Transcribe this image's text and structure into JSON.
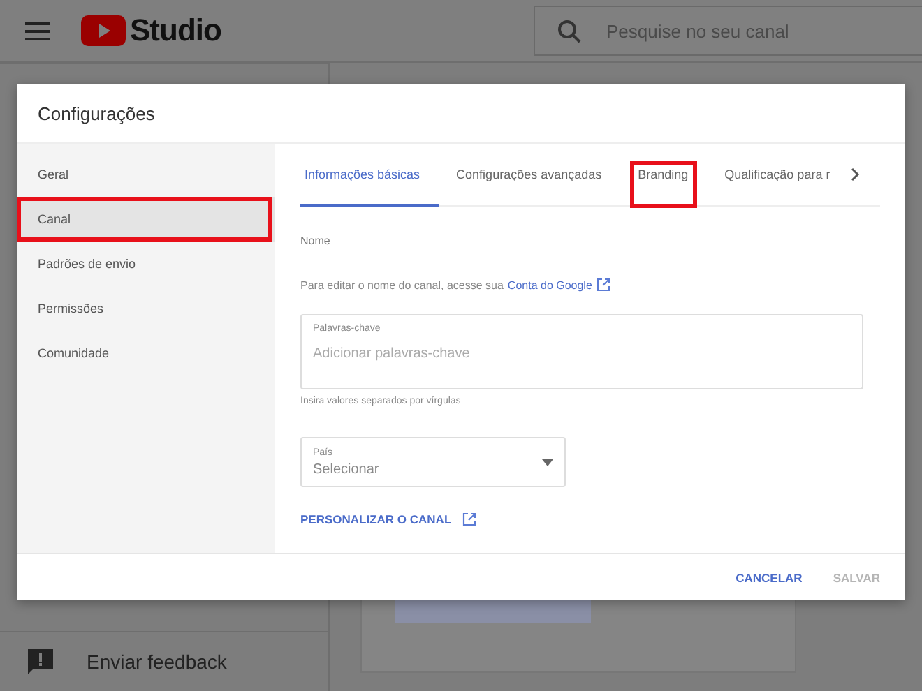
{
  "topbar": {
    "logo": "Studio",
    "search": {
      "placeholder": "Pesquise no seu canal"
    }
  },
  "background_nav": {
    "items": [
      {
        "label": "Enviar feedback",
        "kind": "feedback"
      }
    ]
  },
  "dialog": {
    "title": "Configurações",
    "sidebar": {
      "items": [
        {
          "label": "Geral",
          "selected": false,
          "highlighted": false
        },
        {
          "label": "Canal",
          "selected": true,
          "highlighted": true
        },
        {
          "label": "Padrões de envio",
          "selected": false,
          "highlighted": false
        },
        {
          "label": "Permissões",
          "selected": false,
          "highlighted": false
        },
        {
          "label": "Comunidade",
          "selected": false,
          "highlighted": false
        }
      ]
    },
    "tabs": [
      {
        "label": "Informações básicas",
        "selected": true,
        "highlighted": false
      },
      {
        "label": "Configurações avançadas",
        "selected": false,
        "highlighted": false
      },
      {
        "label": "Branding",
        "selected": false,
        "highlighted": true
      },
      {
        "label": "Qualificação para r",
        "selected": false,
        "highlighted": false
      }
    ],
    "name_label": "Nome",
    "name_hint": "Para editar o nome do canal, acesse sua",
    "name_link": "Conta do Google",
    "keywords": {
      "label": "Palavras-chave",
      "placeholder": "Adicionar palavras-chave",
      "hint": "Insira valores separados por vírgulas"
    },
    "country": {
      "label": "País",
      "value": "Selecionar"
    },
    "customize_link": "PERSONALIZAR O CANAL",
    "buttons": [
      {
        "label": "CANCELAR",
        "disabled": false
      },
      {
        "label": "SALVAR",
        "disabled": true
      }
    ]
  }
}
